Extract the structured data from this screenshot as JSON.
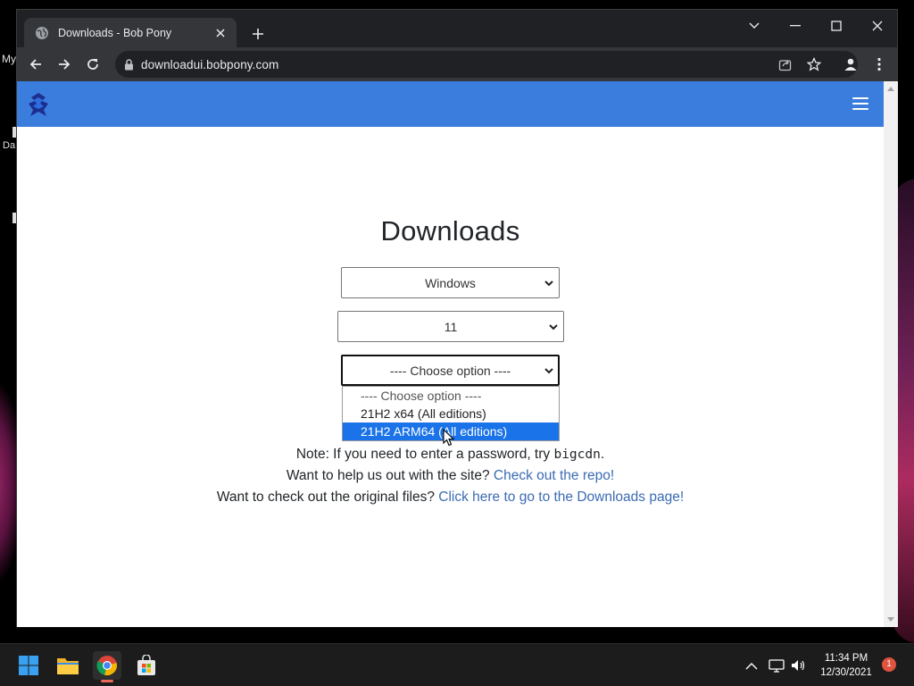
{
  "desktop": {
    "labels": [
      "My",
      "Da"
    ]
  },
  "browser": {
    "tab": {
      "title": "Downloads - Bob Pony"
    },
    "address_bar": {
      "url": "downloadui.bobpony.com"
    }
  },
  "site": {
    "brand_color": "#3b7ddd",
    "title": "Downloads",
    "os_select": {
      "selected": "Windows"
    },
    "version_select": {
      "selected": "11"
    },
    "build_select": {
      "selected": "---- Choose option ----",
      "options": [
        "---- Choose option ----",
        "21H2 x64 (All editions)",
        "21H2 ARM64 (All editions)"
      ],
      "highlighted_index": 2
    },
    "note": {
      "prefix": "Note: If you need to enter a password, try ",
      "code": "bigcdn",
      "suffix": "."
    },
    "help": {
      "text": "Want to help us out with the site? ",
      "link": "Check out the repo!"
    },
    "original": {
      "text": "Want to check out the original files? ",
      "link": "Click here to go to the Downloads page!"
    }
  },
  "taskbar": {
    "items": [
      "start-icon",
      "file-explorer-icon",
      "chrome-icon",
      "store-icon"
    ],
    "clock": {
      "time": "11:34 PM",
      "date": "12/30/2021"
    },
    "notification_count": "1"
  }
}
